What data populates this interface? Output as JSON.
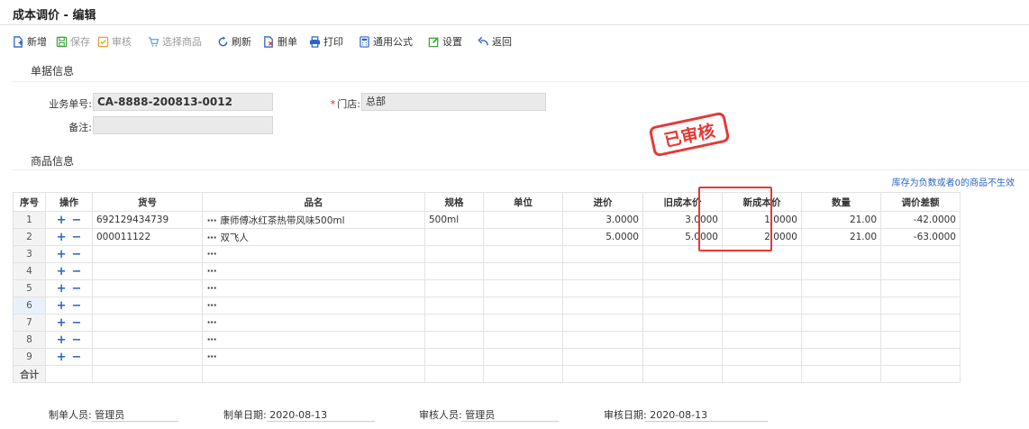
{
  "title": "成本调价 - 编辑",
  "toolbar": {
    "new": "新增",
    "save": "保存",
    "audit": "审核",
    "select_goods": "选择商品",
    "refresh": "刷新",
    "delete": "删单",
    "print": "打印",
    "formula": "通用公式",
    "settings": "设置",
    "back": "返回"
  },
  "doc_section": "单据信息",
  "goods_section": "商品信息",
  "fields": {
    "order_no_label": "业务单号:",
    "order_no": "CA-8888-200813-0012",
    "store_label": "门店:",
    "store": "总部",
    "store_required": "*",
    "remark_label": "备注:",
    "remark": ""
  },
  "stamp": "已审核",
  "note": "库存为负数或者0的商品不生效",
  "table": {
    "headers": [
      "序号",
      "操作",
      "货号",
      "品名",
      "规格",
      "单位",
      "进价",
      "旧成本价",
      "新成本价",
      "数量",
      "调价差额"
    ],
    "rows": [
      {
        "seq": "1",
        "code": "692129434739",
        "name": "康师傅冰红茶热带风味500ml",
        "spec": "500ml",
        "unit": "",
        "price": "3.0000",
        "old_cost": "3.0000",
        "new_cost": "1.0000",
        "qty": "21.00",
        "diff": "-42.0000"
      },
      {
        "seq": "2",
        "code": "000011122",
        "name": "双飞人",
        "spec": "",
        "unit": "",
        "price": "5.0000",
        "old_cost": "5.0000",
        "new_cost": "2.0000",
        "qty": "21.00",
        "diff": "-63.0000"
      },
      {
        "seq": "3",
        "code": "",
        "name": "",
        "spec": "",
        "unit": "",
        "price": "",
        "old_cost": "",
        "new_cost": "",
        "qty": "",
        "diff": ""
      },
      {
        "seq": "4",
        "code": "",
        "name": "",
        "spec": "",
        "unit": "",
        "price": "",
        "old_cost": "",
        "new_cost": "",
        "qty": "",
        "diff": ""
      },
      {
        "seq": "5",
        "code": "",
        "name": "",
        "spec": "",
        "unit": "",
        "price": "",
        "old_cost": "",
        "new_cost": "",
        "qty": "",
        "diff": ""
      },
      {
        "seq": "6",
        "code": "",
        "name": "",
        "spec": "",
        "unit": "",
        "price": "",
        "old_cost": "",
        "new_cost": "",
        "qty": "",
        "diff": ""
      },
      {
        "seq": "7",
        "code": "",
        "name": "",
        "spec": "",
        "unit": "",
        "price": "",
        "old_cost": "",
        "new_cost": "",
        "qty": "",
        "diff": ""
      },
      {
        "seq": "8",
        "code": "",
        "name": "",
        "spec": "",
        "unit": "",
        "price": "",
        "old_cost": "",
        "new_cost": "",
        "qty": "",
        "diff": ""
      },
      {
        "seq": "9",
        "code": "",
        "name": "",
        "spec": "",
        "unit": "",
        "price": "",
        "old_cost": "",
        "new_cost": "",
        "qty": "",
        "diff": ""
      }
    ],
    "total_label": "合计",
    "plus": "+",
    "minus": "−",
    "ellipsis": "⋯"
  },
  "footer": {
    "creator_label": "制单人员:",
    "creator": "管理员",
    "create_date_label": "制单日期:",
    "create_date": "2020-08-13",
    "auditor_label": "审核人员:",
    "auditor": "管理员",
    "audit_date_label": "审核日期:",
    "audit_date": "2020-08-13"
  },
  "colors": {
    "accent": "#2b64c6",
    "stamp": "#e53935",
    "field_bg": "#eaeaea"
  },
  "icons": {
    "new": "new-doc-icon",
    "save": "save-icon",
    "audit": "check-square-icon",
    "select_goods": "cart-icon",
    "refresh": "refresh-icon",
    "delete": "delete-doc-icon",
    "print": "printer-icon",
    "formula": "calculator-icon",
    "settings": "edit-settings-icon",
    "back": "back-arrow-icon"
  }
}
